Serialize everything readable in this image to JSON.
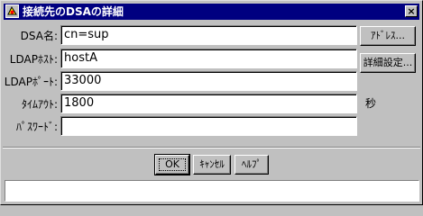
{
  "window": {
    "title": "接続先のDSAの詳細",
    "close_label": "×"
  },
  "form": {
    "dsa_name": {
      "label": "DSA名:",
      "value": "cn=sup"
    },
    "ldap_host": {
      "label": "LDAPﾎｽﾄ:",
      "value": "hostA"
    },
    "ldap_port": {
      "label": "LDAPﾎﾟｰﾄ:",
      "value": "33000"
    },
    "timeout": {
      "label": "ﾀｲﾑｱｳﾄ:",
      "value": "1800",
      "unit": "秒"
    },
    "password": {
      "label": "ﾊﾟｽﾜｰﾄﾞ:",
      "value": ""
    }
  },
  "side_buttons": {
    "address": "ｱﾄﾞﾚｽ...",
    "advanced": "詳細設定..."
  },
  "footer_buttons": {
    "ok": "OK",
    "cancel": "ｷｬﾝｾﾙ",
    "help": "ﾍﾙﾌﾟ"
  },
  "status": {
    "text": ""
  }
}
